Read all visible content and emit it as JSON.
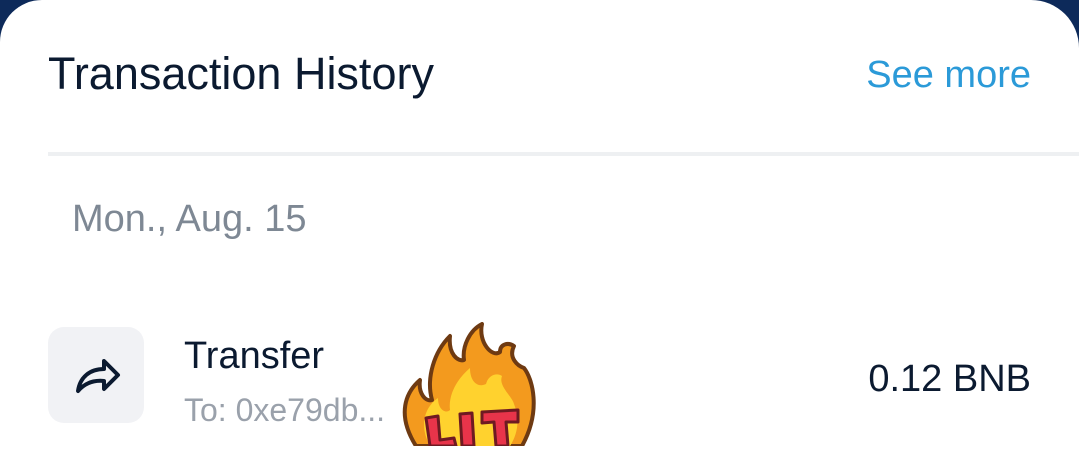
{
  "header": {
    "title": "Transaction History",
    "see_more_label": "See more"
  },
  "date_group": {
    "label": "Mon., Aug. 15"
  },
  "transaction": {
    "type": "Transfer",
    "to": "To: 0xe79db...",
    "amount": "0.12 BNB",
    "icon": "share-arrow-icon"
  },
  "sticker": {
    "icon": "lit-fire-sticker-icon",
    "text": "LIT"
  },
  "colors": {
    "background_frame": "#0d2a5a",
    "card": "#ffffff",
    "title_text": "#0b1a30",
    "link": "#2b9ad8",
    "muted_text": "#7e8894",
    "icon_box": "#f1f2f5",
    "divider": "#eef0f2"
  }
}
